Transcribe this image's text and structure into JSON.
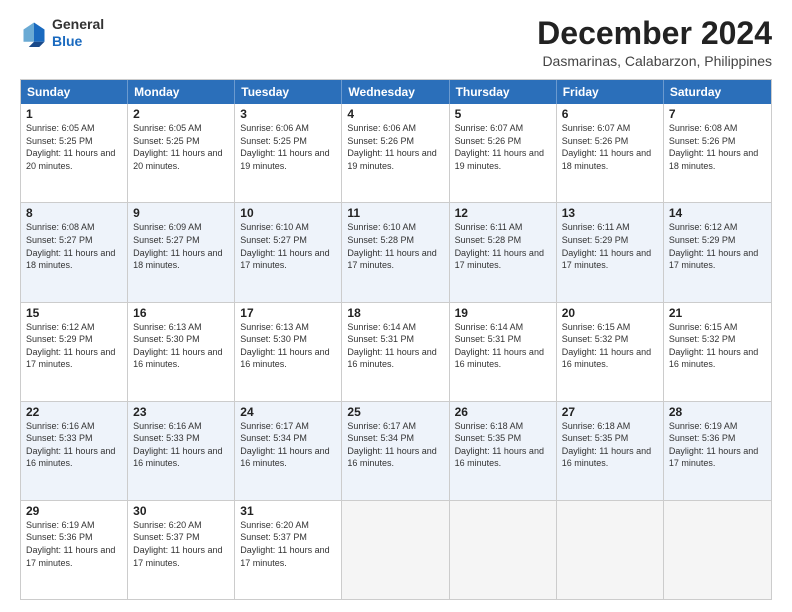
{
  "logo": {
    "general": "General",
    "blue": "Blue"
  },
  "header": {
    "month": "December 2024",
    "location": "Dasmarinas, Calabarzon, Philippines"
  },
  "days": [
    "Sunday",
    "Monday",
    "Tuesday",
    "Wednesday",
    "Thursday",
    "Friday",
    "Saturday"
  ],
  "weeks": [
    [
      {
        "day": "1",
        "sunrise": "6:05 AM",
        "sunset": "5:25 PM",
        "daylight": "11 hours and 20 minutes."
      },
      {
        "day": "2",
        "sunrise": "6:05 AM",
        "sunset": "5:25 PM",
        "daylight": "11 hours and 20 minutes."
      },
      {
        "day": "3",
        "sunrise": "6:06 AM",
        "sunset": "5:25 PM",
        "daylight": "11 hours and 19 minutes."
      },
      {
        "day": "4",
        "sunrise": "6:06 AM",
        "sunset": "5:26 PM",
        "daylight": "11 hours and 19 minutes."
      },
      {
        "day": "5",
        "sunrise": "6:07 AM",
        "sunset": "5:26 PM",
        "daylight": "11 hours and 19 minutes."
      },
      {
        "day": "6",
        "sunrise": "6:07 AM",
        "sunset": "5:26 PM",
        "daylight": "11 hours and 18 minutes."
      },
      {
        "day": "7",
        "sunrise": "6:08 AM",
        "sunset": "5:26 PM",
        "daylight": "11 hours and 18 minutes."
      }
    ],
    [
      {
        "day": "8",
        "sunrise": "6:08 AM",
        "sunset": "5:27 PM",
        "daylight": "11 hours and 18 minutes."
      },
      {
        "day": "9",
        "sunrise": "6:09 AM",
        "sunset": "5:27 PM",
        "daylight": "11 hours and 18 minutes."
      },
      {
        "day": "10",
        "sunrise": "6:10 AM",
        "sunset": "5:27 PM",
        "daylight": "11 hours and 17 minutes."
      },
      {
        "day": "11",
        "sunrise": "6:10 AM",
        "sunset": "5:28 PM",
        "daylight": "11 hours and 17 minutes."
      },
      {
        "day": "12",
        "sunrise": "6:11 AM",
        "sunset": "5:28 PM",
        "daylight": "11 hours and 17 minutes."
      },
      {
        "day": "13",
        "sunrise": "6:11 AM",
        "sunset": "5:29 PM",
        "daylight": "11 hours and 17 minutes."
      },
      {
        "day": "14",
        "sunrise": "6:12 AM",
        "sunset": "5:29 PM",
        "daylight": "11 hours and 17 minutes."
      }
    ],
    [
      {
        "day": "15",
        "sunrise": "6:12 AM",
        "sunset": "5:29 PM",
        "daylight": "11 hours and 17 minutes."
      },
      {
        "day": "16",
        "sunrise": "6:13 AM",
        "sunset": "5:30 PM",
        "daylight": "11 hours and 16 minutes."
      },
      {
        "day": "17",
        "sunrise": "6:13 AM",
        "sunset": "5:30 PM",
        "daylight": "11 hours and 16 minutes."
      },
      {
        "day": "18",
        "sunrise": "6:14 AM",
        "sunset": "5:31 PM",
        "daylight": "11 hours and 16 minutes."
      },
      {
        "day": "19",
        "sunrise": "6:14 AM",
        "sunset": "5:31 PM",
        "daylight": "11 hours and 16 minutes."
      },
      {
        "day": "20",
        "sunrise": "6:15 AM",
        "sunset": "5:32 PM",
        "daylight": "11 hours and 16 minutes."
      },
      {
        "day": "21",
        "sunrise": "6:15 AM",
        "sunset": "5:32 PM",
        "daylight": "11 hours and 16 minutes."
      }
    ],
    [
      {
        "day": "22",
        "sunrise": "6:16 AM",
        "sunset": "5:33 PM",
        "daylight": "11 hours and 16 minutes."
      },
      {
        "day": "23",
        "sunrise": "6:16 AM",
        "sunset": "5:33 PM",
        "daylight": "11 hours and 16 minutes."
      },
      {
        "day": "24",
        "sunrise": "6:17 AM",
        "sunset": "5:34 PM",
        "daylight": "11 hours and 16 minutes."
      },
      {
        "day": "25",
        "sunrise": "6:17 AM",
        "sunset": "5:34 PM",
        "daylight": "11 hours and 16 minutes."
      },
      {
        "day": "26",
        "sunrise": "6:18 AM",
        "sunset": "5:35 PM",
        "daylight": "11 hours and 16 minutes."
      },
      {
        "day": "27",
        "sunrise": "6:18 AM",
        "sunset": "5:35 PM",
        "daylight": "11 hours and 16 minutes."
      },
      {
        "day": "28",
        "sunrise": "6:19 AM",
        "sunset": "5:36 PM",
        "daylight": "11 hours and 17 minutes."
      }
    ],
    [
      {
        "day": "29",
        "sunrise": "6:19 AM",
        "sunset": "5:36 PM",
        "daylight": "11 hours and 17 minutes."
      },
      {
        "day": "30",
        "sunrise": "6:20 AM",
        "sunset": "5:37 PM",
        "daylight": "11 hours and 17 minutes."
      },
      {
        "day": "31",
        "sunrise": "6:20 AM",
        "sunset": "5:37 PM",
        "daylight": "11 hours and 17 minutes."
      },
      null,
      null,
      null,
      null
    ]
  ]
}
